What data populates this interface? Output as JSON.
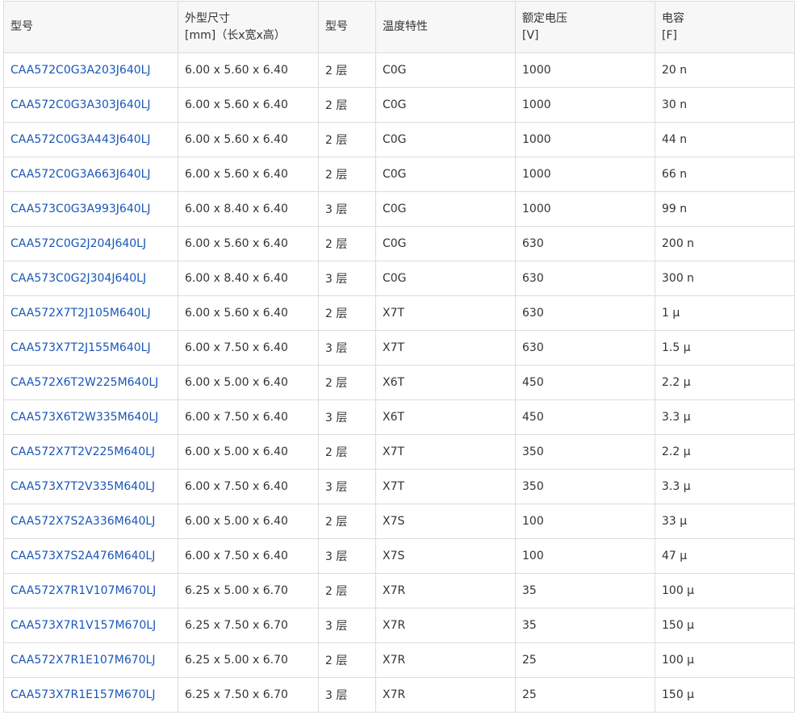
{
  "table": {
    "headers": [
      {
        "lines": [
          "型号"
        ]
      },
      {
        "lines": [
          "外型尺寸",
          "[mm]（长x宽x高）"
        ]
      },
      {
        "lines": [
          "型号"
        ]
      },
      {
        "lines": [
          "温度特性"
        ]
      },
      {
        "lines": [
          "额定电压",
          "[V]"
        ]
      },
      {
        "lines": [
          "电容",
          "[F]"
        ]
      }
    ],
    "rows": [
      [
        "CAA572C0G3A203J640LJ",
        "6.00 x 5.60 x 6.40",
        "2 层",
        "C0G",
        "1000",
        "20 n"
      ],
      [
        "CAA572C0G3A303J640LJ",
        "6.00 x 5.60 x 6.40",
        "2 层",
        "C0G",
        "1000",
        "30 n"
      ],
      [
        "CAA572C0G3A443J640LJ",
        "6.00 x 5.60 x 6.40",
        "2 层",
        "C0G",
        "1000",
        "44 n"
      ],
      [
        "CAA572C0G3A663J640LJ",
        "6.00 x 5.60 x 6.40",
        "2 层",
        "C0G",
        "1000",
        "66 n"
      ],
      [
        "CAA573C0G3A993J640LJ",
        "6.00 x 8.40 x 6.40",
        "3 层",
        "C0G",
        "1000",
        "99 n"
      ],
      [
        "CAA572C0G2J204J640LJ",
        "6.00 x 5.60 x 6.40",
        "2 层",
        "C0G",
        "630",
        "200 n"
      ],
      [
        "CAA573C0G2J304J640LJ",
        "6.00 x 8.40 x 6.40",
        "3 层",
        "C0G",
        "630",
        "300 n"
      ],
      [
        "CAA572X7T2J105M640LJ",
        "6.00 x 5.60 x 6.40",
        "2 层",
        "X7T",
        "630",
        "1 μ"
      ],
      [
        "CAA573X7T2J155M640LJ",
        "6.00 x 7.50 x 6.40",
        "3 层",
        "X7T",
        "630",
        "1.5 μ"
      ],
      [
        "CAA572X6T2W225M640LJ",
        "6.00 x 5.00 x 6.40",
        "2 层",
        "X6T",
        "450",
        "2.2 μ"
      ],
      [
        "CAA573X6T2W335M640LJ",
        "6.00 x 7.50 x 6.40",
        "3 层",
        "X6T",
        "450",
        "3.3 μ"
      ],
      [
        "CAA572X7T2V225M640LJ",
        "6.00 x 5.00 x 6.40",
        "2 层",
        "X7T",
        "350",
        "2.2 μ"
      ],
      [
        "CAA573X7T2V335M640LJ",
        "6.00 x 7.50 x 6.40",
        "3 层",
        "X7T",
        "350",
        "3.3 μ"
      ],
      [
        "CAA572X7S2A336M640LJ",
        "6.00 x 5.00 x 6.40",
        "2 层",
        "X7S",
        "100",
        "33 μ"
      ],
      [
        "CAA573X7S2A476M640LJ",
        "6.00 x 7.50 x 6.40",
        "3 层",
        "X7S",
        "100",
        "47 μ"
      ],
      [
        "CAA572X7R1V107M670LJ",
        "6.25 x 5.00 x 6.70",
        "2 层",
        "X7R",
        "35",
        "100 μ"
      ],
      [
        "CAA573X7R1V157M670LJ",
        "6.25 x 7.50 x 6.70",
        "3 层",
        "X7R",
        "35",
        "150 μ"
      ],
      [
        "CAA572X7R1E107M670LJ",
        "6.25 x 5.00 x 6.70",
        "2 层",
        "X7R",
        "25",
        "100 μ"
      ],
      [
        "CAA573X7R1E157M670LJ",
        "6.25 x 7.50 x 6.70",
        "3 层",
        "X7R",
        "25",
        "150 μ"
      ]
    ]
  },
  "colors": {
    "link": "#1a56b8",
    "text": "#333333",
    "header_bg": "#f7f7f7",
    "border": "#dcdcdc"
  }
}
